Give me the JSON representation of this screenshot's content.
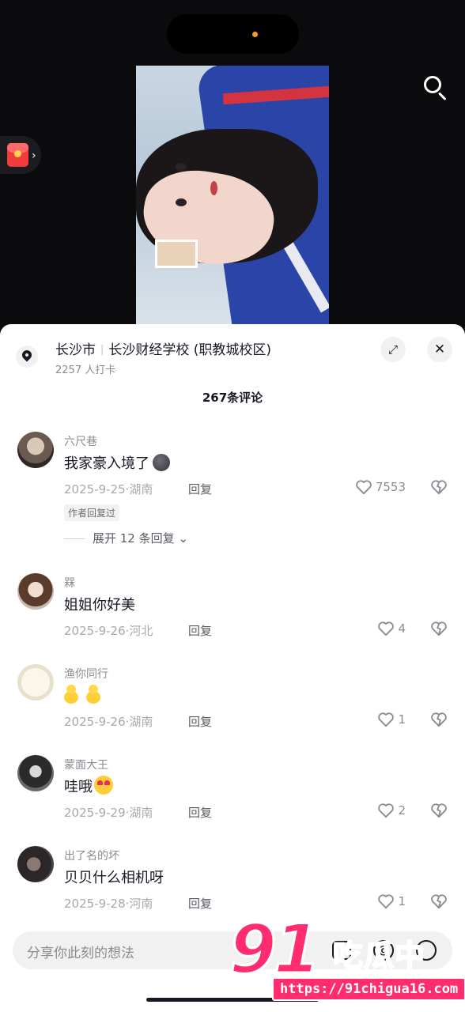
{
  "location": {
    "city": "长沙市",
    "place": "长沙财经学校 (职教城校区)",
    "checkins": "2257 人打卡"
  },
  "comment_count": "267条评论",
  "comments": [
    {
      "user": "六尺巷",
      "text": "我家豪入境了",
      "date": "2025-9-25",
      "region": "湖南",
      "likes": "7553",
      "author_replied": "作者回复过",
      "expand": "展开 12 条回复"
    },
    {
      "user": "槑",
      "text": "姐姐你好美",
      "date": "2025-9-26",
      "region": "河北",
      "likes": "4"
    },
    {
      "user": "渔你同行",
      "text": "",
      "date": "2025-9-26",
      "region": "湖南",
      "likes": "1"
    },
    {
      "user": "蒙面大王",
      "text": "哇哦",
      "date": "2025-9-29",
      "region": "湖南",
      "likes": "2"
    },
    {
      "user": "出了名的坏",
      "text": "贝贝什么相机呀",
      "date": "2025-9-28",
      "region": "河南",
      "likes": "1"
    }
  ],
  "reply_label": "回复",
  "dot_sep": "·",
  "input_placeholder": "分享你此刻的想法",
  "watermark": {
    "brand": "91",
    "name": "吃瓜中心",
    "url": "https://91chigua16.com"
  },
  "icons": {
    "search": "search-icon",
    "red_packet": "red-packet-icon",
    "location": "location-pin-icon",
    "expand": "expand-icon",
    "close": "close-icon",
    "like": "heart-icon",
    "dislike": "dislike-icon"
  },
  "colors": {
    "accent": "#ff2d6f",
    "text": "#161823",
    "muted": "#8a8b91"
  }
}
